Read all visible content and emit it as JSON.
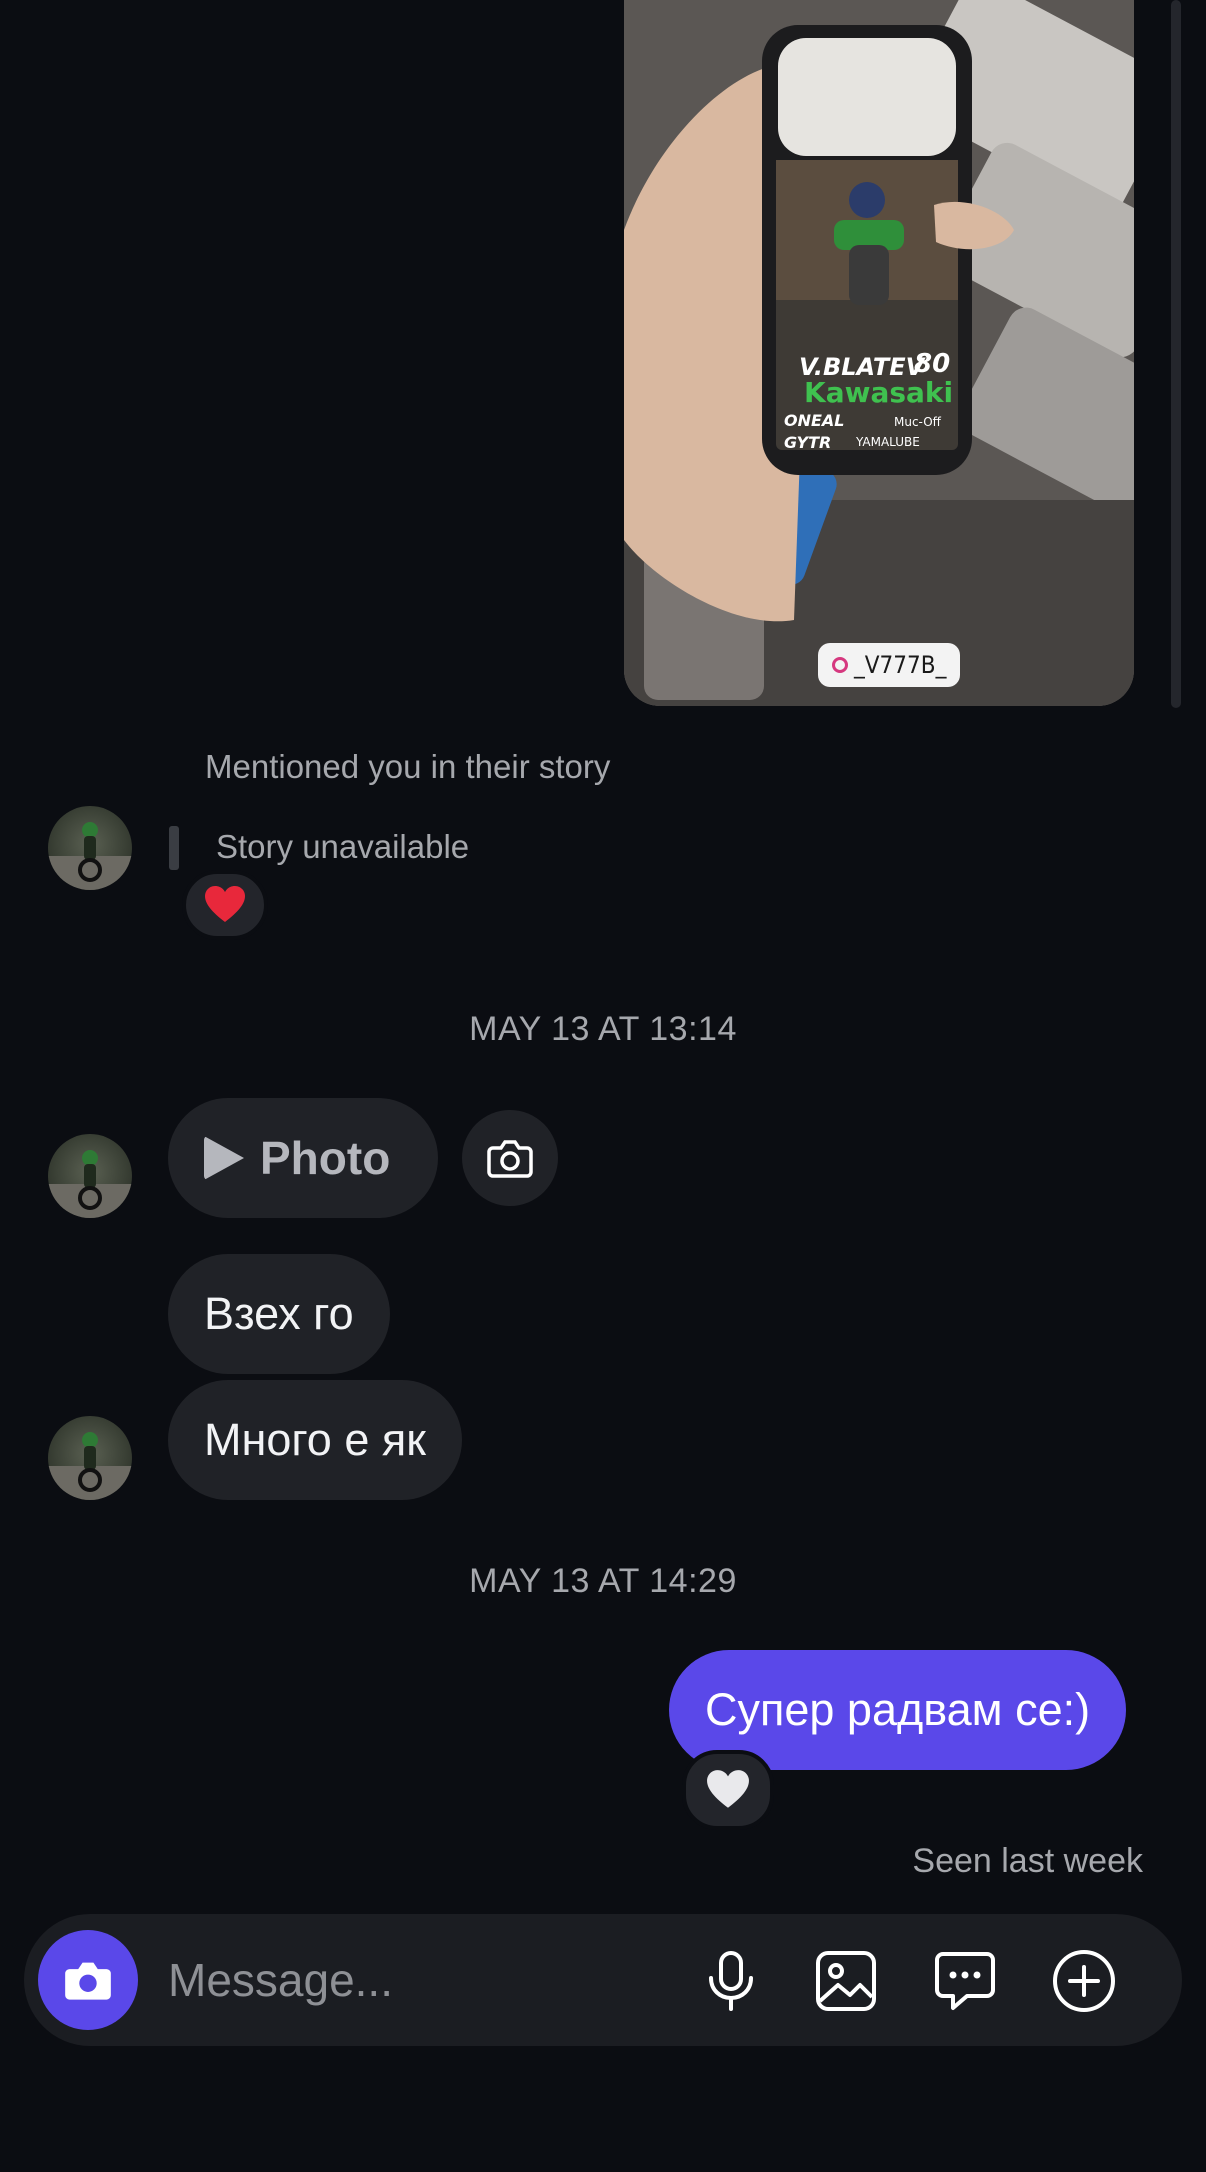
{
  "story": {
    "tag_label": "_V777B_",
    "mention_text": "Mentioned you in their story",
    "unavailable_text": "Story unavailable",
    "reaction_icon": "red-heart",
    "case_texts": {
      "rider": "V.BLATEV",
      "number": "80",
      "brand": "Kawasaki",
      "sponsor1": "ONEAL",
      "sponsor2": "Muc-Off",
      "sponsor3": "GYTR",
      "sponsor4": "YAMALUBE"
    }
  },
  "separators": {
    "first": "MAY 13 AT 13:14",
    "second": "MAY 13 AT 14:29"
  },
  "messages": {
    "photo_label": "Photo",
    "msg1": "Взех го",
    "msg2": "Много е як",
    "own_msg": "Супер радвам се:)",
    "own_reaction_icon": "white-heart",
    "seen_status": "Seen last week"
  },
  "composer": {
    "placeholder": "Message..."
  },
  "colors": {
    "background": "#0b0d12",
    "bubble_incoming": "#202227",
    "bubble_outgoing": "#5a48e9",
    "accent": "#5a48e9"
  }
}
